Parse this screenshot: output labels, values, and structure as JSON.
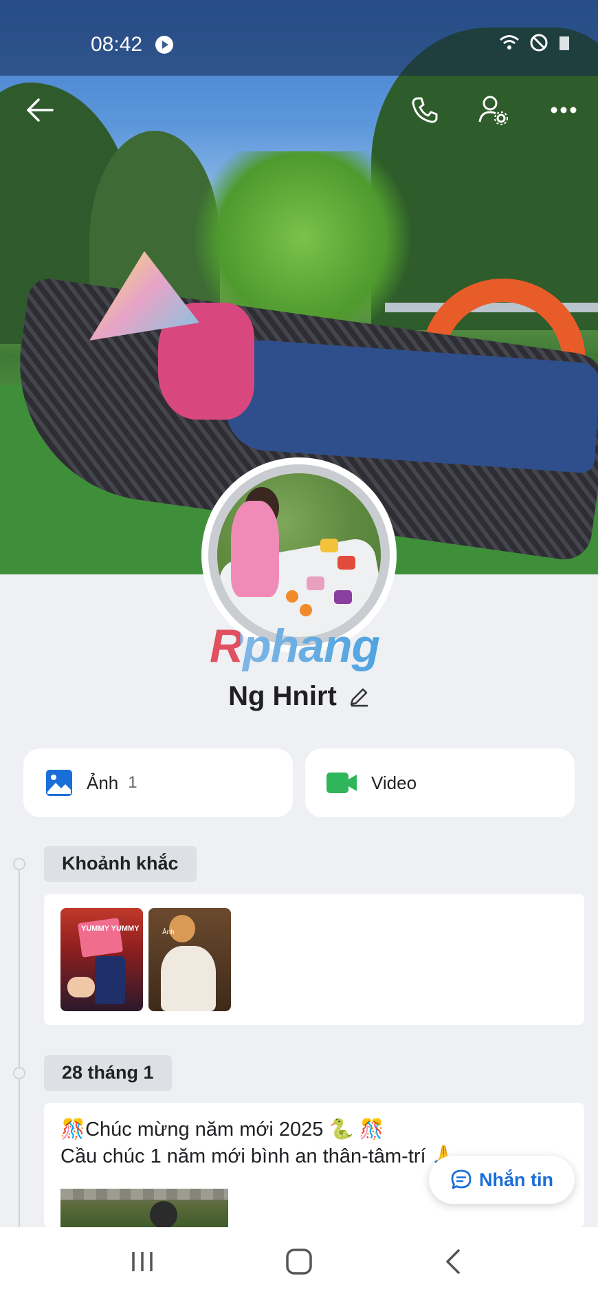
{
  "status_bar": {
    "time": "08:42"
  },
  "profile": {
    "name": "Ng Hnirt",
    "watermark": "Rphang"
  },
  "media": {
    "photos": {
      "label": "Ảnh",
      "count": "1"
    },
    "videos": {
      "label": "Video"
    }
  },
  "timeline": {
    "moments_label": "Khoảnh khắc",
    "moment_thumbs": [
      {
        "caption": "YUMMY YUMMY"
      },
      {
        "caption": "Ảnh"
      }
    ],
    "post_date": "28 tháng 1",
    "post_line1": "🎊Chúc mừng năm mới  2025 🐍 🎊",
    "post_line2": "Cầu chúc 1 năm mới bình an thân-tâm-trí 🙏"
  },
  "message_button": {
    "label": "Nhắn tin"
  },
  "colors": {
    "accent": "#1a6ed8",
    "photo_icon": "#1a6ed8",
    "video_icon": "#2fb55a"
  },
  "icons": [
    "back-arrow-icon",
    "phone-icon",
    "user-settings-icon",
    "more-icon",
    "edit-pencil-icon",
    "image-icon",
    "video-camera-icon",
    "chat-bubble-icon"
  ]
}
